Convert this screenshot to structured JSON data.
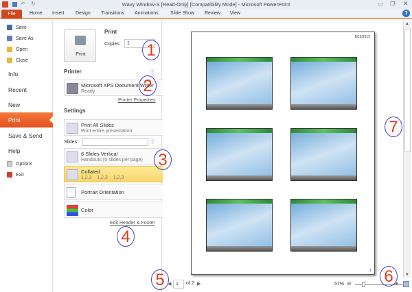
{
  "window": {
    "title": "Wavy Window-S [Read-Only] [Compatibility Mode]  -  Microsoft PowerPoint"
  },
  "ribbon": {
    "tabs": [
      "File",
      "Home",
      "Insert",
      "Design",
      "Transitions",
      "Animations",
      "Slide Show",
      "Review",
      "View"
    ]
  },
  "nav": {
    "small_top": [
      "Save",
      "Save As",
      "Open",
      "Close"
    ],
    "big": [
      "Info",
      "Recent",
      "New",
      "Print",
      "Save & Send",
      "Help"
    ],
    "small_bottom": [
      "Options",
      "Exit"
    ]
  },
  "print": {
    "heading": "Print",
    "button": "Print",
    "copies_label": "Copies:",
    "copies_value": "1"
  },
  "printer": {
    "heading": "Printer",
    "name": "Microsoft XPS Document Writer",
    "status": "Ready",
    "properties_link": "Printer Properties"
  },
  "settings": {
    "heading": "Settings",
    "slides_label": "Slides:",
    "slides_value": "",
    "dropdowns": [
      {
        "title": "Print All Slides",
        "sub": "Print entire presentation"
      },
      {
        "title": "6 Slides Vertical",
        "sub": "Handouts (6 slides per page)"
      },
      {
        "title": "Collated",
        "sub": "1,2,3    1,2,3    1,2,3"
      },
      {
        "title": "Portrait Orientation",
        "sub": ""
      },
      {
        "title": "Color",
        "sub": ""
      }
    ],
    "header_footer_link": "Edit Header & Footer"
  },
  "preview": {
    "date": "8/15/2013",
    "page_number": "1",
    "current_page": "1",
    "of_pages": "of 2",
    "zoom": "57%"
  },
  "annotations": [
    "1",
    "2",
    "3",
    "4",
    "5",
    "6",
    "7"
  ]
}
